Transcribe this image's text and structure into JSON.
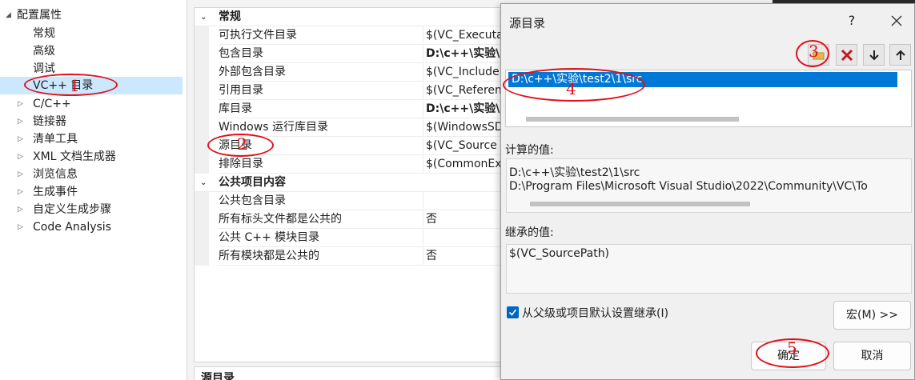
{
  "tree": {
    "root": "配置属性",
    "items": [
      {
        "label": "常规",
        "expandable": false
      },
      {
        "label": "高级",
        "expandable": false
      },
      {
        "label": "调试",
        "expandable": false
      },
      {
        "label": "VC++ 目录",
        "expandable": false,
        "selected": true
      },
      {
        "label": "C/C++",
        "expandable": true
      },
      {
        "label": "链接器",
        "expandable": true
      },
      {
        "label": "清单工具",
        "expandable": true
      },
      {
        "label": "XML 文档生成器",
        "expandable": true
      },
      {
        "label": "浏览信息",
        "expandable": true
      },
      {
        "label": "生成事件",
        "expandable": true
      },
      {
        "label": "自定义生成步骤",
        "expandable": true
      },
      {
        "label": "Code Analysis",
        "expandable": true
      }
    ]
  },
  "grid": {
    "cat_general": "常规",
    "cat_public": "公共项目内容",
    "rows": [
      {
        "name": "可执行文件目录",
        "value": "$(VC_Executa"
      },
      {
        "name": "包含目录",
        "value": "D:\\c++\\实验\\"
      },
      {
        "name": "外部包含目录",
        "value": "$(VC_Include"
      },
      {
        "name": "引用目录",
        "value": "$(VC_Referen"
      },
      {
        "name": "库目录",
        "value": "D:\\c++\\实验\\"
      },
      {
        "name": "Windows 运行库目录",
        "value": "$(WindowsSD"
      },
      {
        "name": "源目录",
        "value": "$(VC_Source"
      },
      {
        "name": "排除目录",
        "value": "$(CommonEx"
      }
    ],
    "public_rows": [
      {
        "name": "公共包含目录",
        "value": ""
      },
      {
        "name": "所有标头文件都是公共的",
        "value": "否"
      },
      {
        "name": "公共 C++ 模块目录",
        "value": ""
      },
      {
        "name": "所有模块都是公共的",
        "value": "否"
      }
    ]
  },
  "description_title": "源目录",
  "dialog": {
    "title": "源目录",
    "help": "?",
    "list_items": [
      "D:\\c++\\实验\\test2\\1\\src"
    ],
    "evaluated_label": "计算的值:",
    "evaluated_values": [
      "D:\\c++\\实验\\test2\\1\\src",
      "D:\\Program Files\\Microsoft Visual Studio\\2022\\Community\\VC\\To"
    ],
    "inherited_label": "继承的值:",
    "inherited_values": [
      "$(VC_SourcePath)"
    ],
    "inherit_checkbox": {
      "label": "从父级或项目默认设置继承(I)",
      "checked": true
    },
    "macro_button": "宏(M) >>",
    "ok_button": "确定",
    "cancel_button": "取消"
  },
  "annotations": [
    "1",
    "2",
    "3",
    "4",
    "5"
  ],
  "colors": {
    "selection": "#0078d7",
    "tree_selection": "#cce8ff",
    "annotation": "#e0101a",
    "checkbox": "#0067c0"
  }
}
